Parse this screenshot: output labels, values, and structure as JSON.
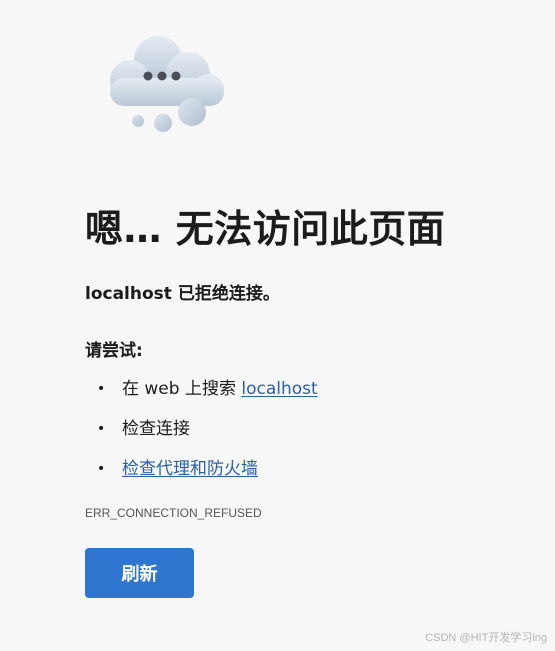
{
  "illustration": {
    "icon": "thinking-cloud-icon"
  },
  "error": {
    "title": "嗯… 无法访问此页面",
    "subtitle": "localhost 已拒绝连接。",
    "try_heading": "请尝试:",
    "suggestions": [
      {
        "prefix": "在 web 上搜索 ",
        "link": "localhost"
      },
      {
        "text": "检查连接"
      },
      {
        "link": "检查代理和防火墙"
      }
    ],
    "code": "ERR_CONNECTION_REFUSED"
  },
  "actions": {
    "refresh_label": "刷新"
  },
  "watermark": "CSDN @HIT开发学习ing",
  "colors": {
    "background": "#f7f7f7",
    "primary_button": "#2e76d0",
    "link": "#2b5fa8"
  }
}
